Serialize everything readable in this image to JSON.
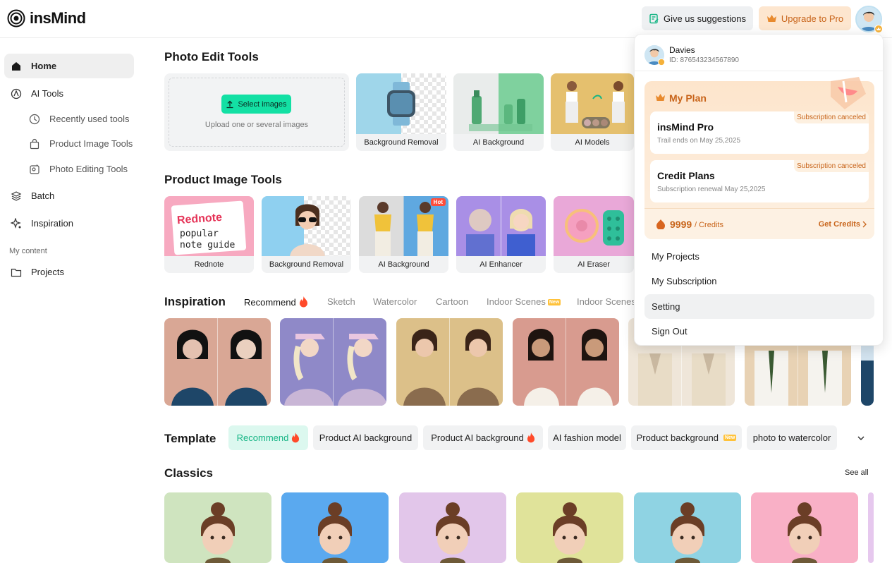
{
  "header": {
    "logo_text": "insMind",
    "suggest_label": "Give us suggestions",
    "upgrade_label": "Upgrade to Pro"
  },
  "sidebar": {
    "items": [
      {
        "label": "Home",
        "icon": "home-icon"
      },
      {
        "label": "AI Tools",
        "icon": "ai-tools-icon"
      },
      {
        "label": "Recently used tools",
        "icon": "clock-icon"
      },
      {
        "label": "Product Image Tools",
        "icon": "bag-icon"
      },
      {
        "label": "Photo Editing Tools",
        "icon": "photo-edit-icon"
      },
      {
        "label": "Batch",
        "icon": "layers-icon"
      },
      {
        "label": "Inspiration",
        "icon": "sparkle-icon"
      }
    ],
    "my_content_label": "My content",
    "projects_label": "Projects"
  },
  "photo_edit": {
    "title": "Photo Edit Tools",
    "select_label": "Select images",
    "upload_hint": "Upload one or several images",
    "tools": [
      "Background Removal",
      "AI Background",
      "AI Models"
    ]
  },
  "product_tools": {
    "title": "Product Image Tools",
    "tools": [
      "Rednote",
      "Background Removal",
      "AI Background",
      "AI Enhancer",
      "AI Eraser"
    ],
    "rednote_art": [
      "Rednote",
      "popular",
      "note guide"
    ],
    "hot_badge": "Hot"
  },
  "inspiration": {
    "title": "Inspiration",
    "tabs": [
      "Recommend",
      "Sketch",
      "Watercolor",
      "Cartoon",
      "Indoor Scenes",
      "Indoor Scenes"
    ],
    "new_badge": "New"
  },
  "template": {
    "title": "Template",
    "chips": [
      "Recommend",
      "Product AI background",
      "Product AI background",
      "AI fashion model",
      "Product background",
      "photo to watercolor"
    ]
  },
  "classics": {
    "title": "Classics",
    "see_all": "See all"
  },
  "dropdown": {
    "user_name": "Davies",
    "user_id": "ID: 876543234567890",
    "plan_title": "My Plan",
    "pro_title": "insMind Pro",
    "pro_sub": "Trail ends on May 25,2025",
    "pro_tag": "Subscription canceled",
    "credit_title": "Credit Plans",
    "credit_sub": "Subscription renewal May 25,2025",
    "credit_tag": "Subscription canceled",
    "credits_amount": "9999",
    "credits_unit": "/ Credits",
    "get_credits": "Get Credits",
    "menu": [
      "My Projects",
      "My Subscription",
      "Setting",
      "Sign Out"
    ]
  }
}
